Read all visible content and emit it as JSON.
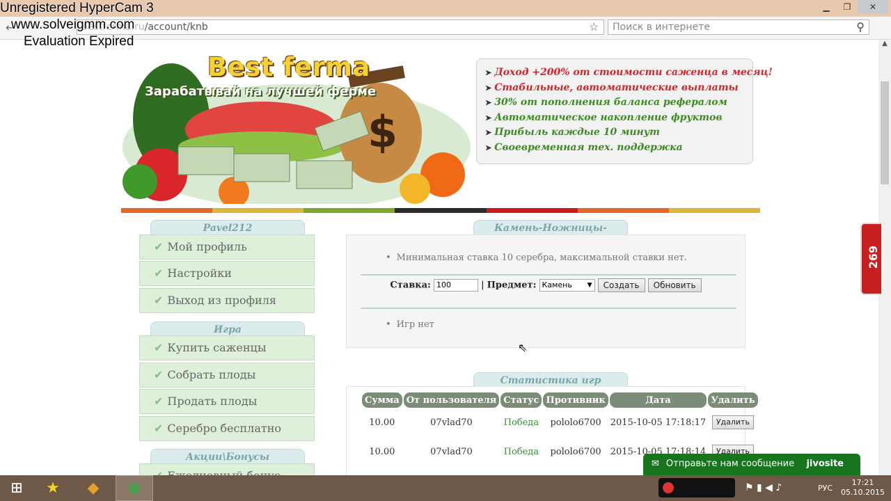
{
  "watermark": {
    "line1": "Unregistered HyperCam 3",
    "line2": "www.solveigmm.com",
    "line3": "Evaluation Expired"
  },
  "browser": {
    "url_domain": "bestferma.ru",
    "url_path": "/account/knb",
    "search_placeholder": "Поиск в интернете",
    "window_buttons": [
      "▁",
      "❐",
      "✕"
    ]
  },
  "banner": {
    "title": "Best ferma",
    "subtitle": "Зарабатывай на лучшей ферме"
  },
  "features": [
    {
      "text": "Доход +200% от стоимости саженца в месяц!",
      "color": "#d8232a"
    },
    {
      "text": "Стабильные, автоматические выплаты",
      "color": "#d8232a"
    },
    {
      "text": "30% от пополнения баланса рефералом",
      "color": "#3e8a24"
    },
    {
      "text": "Автоматическое накопление фруктов",
      "color": "#3e8a24"
    },
    {
      "text": "Прибыль каждые 10 минут",
      "color": "#3e8a24"
    },
    {
      "text": "Своевременная тех. поддержка",
      "color": "#3e8a24"
    }
  ],
  "stripe_colors": [
    "#e2682a",
    "#d9b73a",
    "#7fa62f",
    "#2a2a2a",
    "#c91d1d",
    "#e2682a",
    "#d9b73a"
  ],
  "sidebar": {
    "sections": [
      {
        "title": "Pavel212",
        "items": [
          "Мой профиль",
          "Настройки",
          "Выход из профиля"
        ]
      },
      {
        "title": "Игра",
        "items": [
          "Купить саженцы",
          "Собрать плоды",
          "Продать плоды",
          "Серебро бесплатно"
        ]
      },
      {
        "title": "Акции\\Бонусы",
        "items": [
          "Ежедневный бонус"
        ]
      }
    ]
  },
  "game": {
    "title": "Камень-Ножницы-Бумага",
    "info": "Минимальная ставка 10 серебра, максимальной ставки нет.",
    "bet_label": "Ставка:",
    "bet_value": "100",
    "item_label": "Предмет:",
    "item_value": "Камень",
    "create_label": "Создать",
    "refresh_label": "Обновить",
    "no_games": "Игр нет"
  },
  "stats": {
    "title": "Статистика игр",
    "columns": [
      "Сумма",
      "От пользователя",
      "Статус",
      "Противник",
      "Дата",
      "Удалить"
    ],
    "rows": [
      {
        "sum": "10.00",
        "from": "07vlad70",
        "status": "Победа",
        "opponent": "pololo6700",
        "date": "2015-10-05 17:18:17",
        "delete": "Удалить"
      },
      {
        "sum": "10.00",
        "from": "07vlad70",
        "status": "Победа",
        "opponent": "pololo6700",
        "date": "2015-10-05 17:18:14",
        "delete": "Удалить"
      }
    ]
  },
  "jivo": {
    "text": "Отправьте нам сообщение",
    "brand": "jivosite"
  },
  "side_badge": "269",
  "taskbar": {
    "lang": "РУС",
    "time": "17:21",
    "date": "05.10.2015"
  }
}
